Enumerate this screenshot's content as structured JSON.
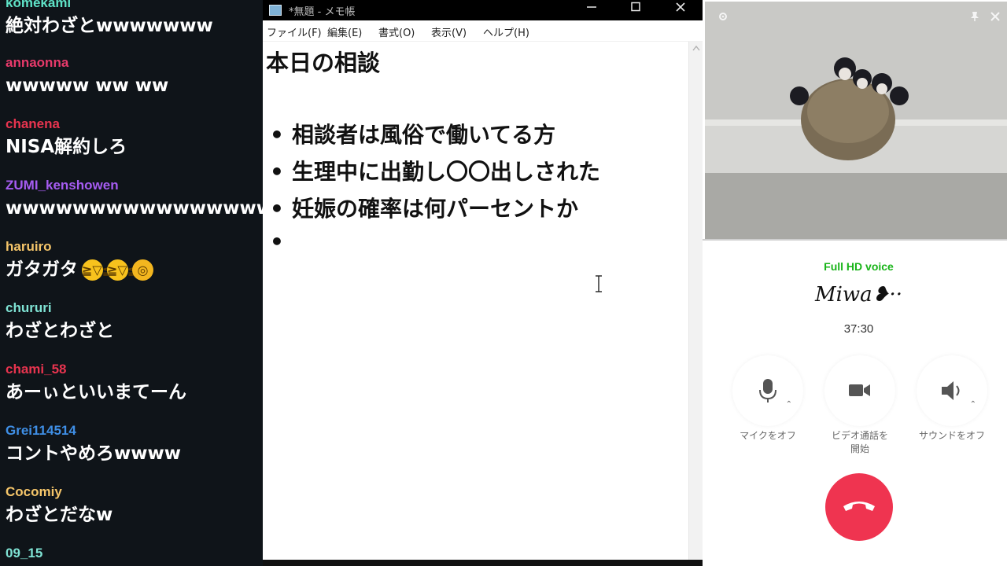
{
  "chat": {
    "messages": [
      {
        "user": "komekami",
        "user_color": "#5fe3c7",
        "text": "絶対わざとwwwwwww"
      },
      {
        "user": "annaonna",
        "user_color": "#e83a6b",
        "text": "wwwww ww ww"
      },
      {
        "user": "chanena",
        "user_color": "#e8344f",
        "text": "NISA解約しろ"
      },
      {
        "user": "ZUMI_kenshowen",
        "user_color": "#a65cf2",
        "text": "wwwwwwwwwwwwwwwwwww"
      },
      {
        "user": "haruiro",
        "user_color": "#f6c66a",
        "text": "ガタガタ",
        "emojis": [
          "rofl-emoji",
          "rofl-emoji",
          "scream-emoji"
        ]
      },
      {
        "user": "chururi",
        "user_color": "#7fe3d4",
        "text": "わざとわざと"
      },
      {
        "user": "chami_58",
        "user_color": "#e8344f",
        "text": "あーぃといいまてーん"
      },
      {
        "user": "Grei114514",
        "user_color": "#3f8fe6",
        "text": "コントやめろwwww"
      },
      {
        "user": "Cocomiy",
        "user_color": "#f6c66a",
        "text": "わざとだなw"
      },
      {
        "user": "09_15",
        "user_color": "#7fe3d4",
        "text": ""
      }
    ]
  },
  "notepad": {
    "title": "*無題 - メモ帳",
    "menu": [
      "ファイル(F)",
      "編集(E)",
      "書式(O)",
      "表示(V)",
      "ヘルプ(H)"
    ],
    "heading": "本日の相談",
    "bullets": [
      "相談者は風俗で働いてる方",
      "生理中に出勤し〇〇出しされた",
      "妊娠の確率は何パーセントか",
      ""
    ],
    "bullet_char": "•"
  },
  "call": {
    "status": "Full HD voice",
    "contact_name": "Miwa❥··",
    "timer": "37:30",
    "controls": {
      "mic_label": "マイクをオフ",
      "video_label_1": "ビデオ通話を",
      "video_label_2": "開始",
      "sound_label": "サウンドをオフ"
    },
    "status_color": "#18b418",
    "hangup_color": "#ef3450"
  }
}
